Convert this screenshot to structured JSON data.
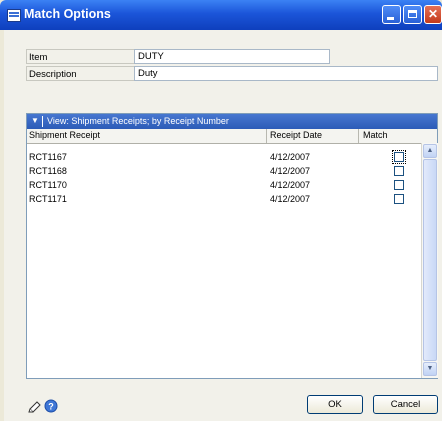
{
  "window": {
    "title": "Match Options"
  },
  "fields": {
    "item_label": "Item",
    "item_value": "DUTY",
    "description_label": "Description",
    "description_value": "Duty"
  },
  "grid": {
    "view_label": "View: Shipment Receipts; by Receipt Number",
    "columns": [
      "Shipment Receipt",
      "Receipt Date",
      "Match"
    ],
    "rows": [
      {
        "receipt": "RCT1167",
        "date": "4/12/2007",
        "match": false
      },
      {
        "receipt": "RCT1168",
        "date": "4/12/2007",
        "match": false
      },
      {
        "receipt": "RCT1170",
        "date": "4/12/2007",
        "match": false
      },
      {
        "receipt": "RCT1171",
        "date": "4/12/2007",
        "match": false
      }
    ]
  },
  "buttons": {
    "ok": "OK",
    "cancel": "Cancel"
  },
  "icons": [
    "window-menu-icon",
    "minimize-icon",
    "maximize-icon",
    "close-icon",
    "note-icon",
    "help-icon",
    "scroll-up-icon",
    "scroll-down-icon",
    "dropdown-chevron-icon"
  ]
}
